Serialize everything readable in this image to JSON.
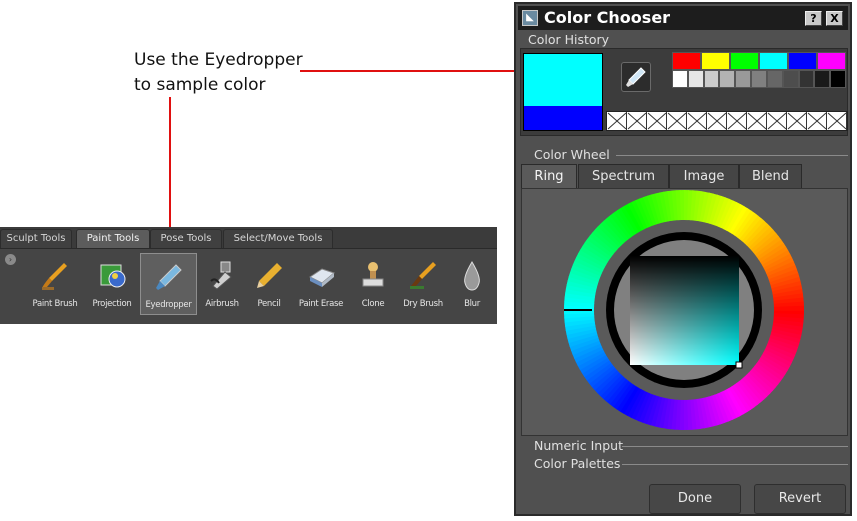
{
  "callout": {
    "line1": "Use the Eyedropper",
    "line2": "to sample color"
  },
  "toolbar": {
    "tabs": [
      "Sculpt Tools",
      "Paint Tools",
      "Pose Tools",
      "Select/Move Tools"
    ],
    "active_tab": "Paint Tools",
    "tools": [
      "Paint Brush",
      "Projection",
      "Eyedropper",
      "Airbrush",
      "Pencil",
      "Paint Erase",
      "Clone",
      "Dry Brush",
      "Blur"
    ],
    "selected_tool": "Eyedropper"
  },
  "chooser": {
    "title": "Color Chooser",
    "help_button": "?",
    "close_button": "X",
    "history_label": "Color History",
    "wheel_label": "Color Wheel",
    "wheel_tabs": [
      "Ring",
      "Spectrum",
      "Image",
      "Blend"
    ],
    "active_wheel_tab": "Ring",
    "numeric_label": "Numeric Input",
    "palettes_label": "Color Palettes",
    "done_button": "Done",
    "revert_button": "Revert",
    "current_color": "#00ffff",
    "previous_color": "#0000ff",
    "palette_top": [
      "#ff0000",
      "#ffff00",
      "#00ff00",
      "#00ffff",
      "#0000ff",
      "#ff00ff"
    ],
    "palette_gray": [
      "#ffffff",
      "#e6e6e6",
      "#cccccc",
      "#b3b3b3",
      "#999999",
      "#808080",
      "#666666",
      "#4d4d4d",
      "#333333",
      "#1a1a1a",
      "#000000"
    ]
  }
}
